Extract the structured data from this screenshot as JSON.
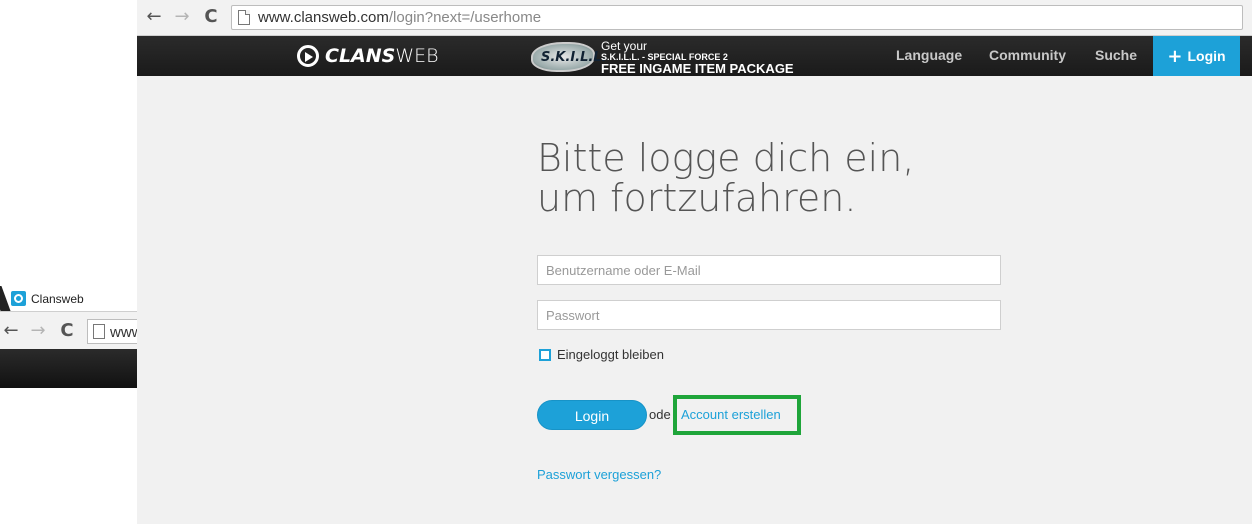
{
  "browser": {
    "back_icon": "←",
    "forward_icon": "→",
    "reload_icon": "C",
    "url_host": "www.clansweb.com",
    "url_path": "/login?next=/userhome"
  },
  "site_nav": {
    "logo_bold": "CLANS",
    "logo_light": "WEB",
    "banner": {
      "badge_text": "S.K.I.L.L.",
      "line1": "Get your",
      "line2": "S.K.I.L.L. - SPECIAL FORCE 2",
      "line3": "FREE INGAME ITEM PACKAGE"
    },
    "links": {
      "language": "Language",
      "community": "Community",
      "search": "Suche"
    },
    "login_plus": "+",
    "login_label": "Login"
  },
  "login": {
    "heading": "Bitte logge dich ein, um fortzufahren.",
    "username_placeholder": "Benutzername oder E-Mail",
    "password_placeholder": "Passwort",
    "remember_label": "Eingeloggt bleiben",
    "login_button": "Login",
    "or_text": "ode",
    "create_account": "Account erstellen",
    "forgot_password": "Passwort vergessen?"
  },
  "bg_window": {
    "tab_title": "Clansweb",
    "back_icon": "←",
    "forward_icon": "→",
    "reload_icon": "C",
    "url_partial": "www"
  },
  "colors": {
    "accent": "#1da1d8",
    "highlight_box": "#1fa53a",
    "navbar": "#1a1a1a"
  }
}
